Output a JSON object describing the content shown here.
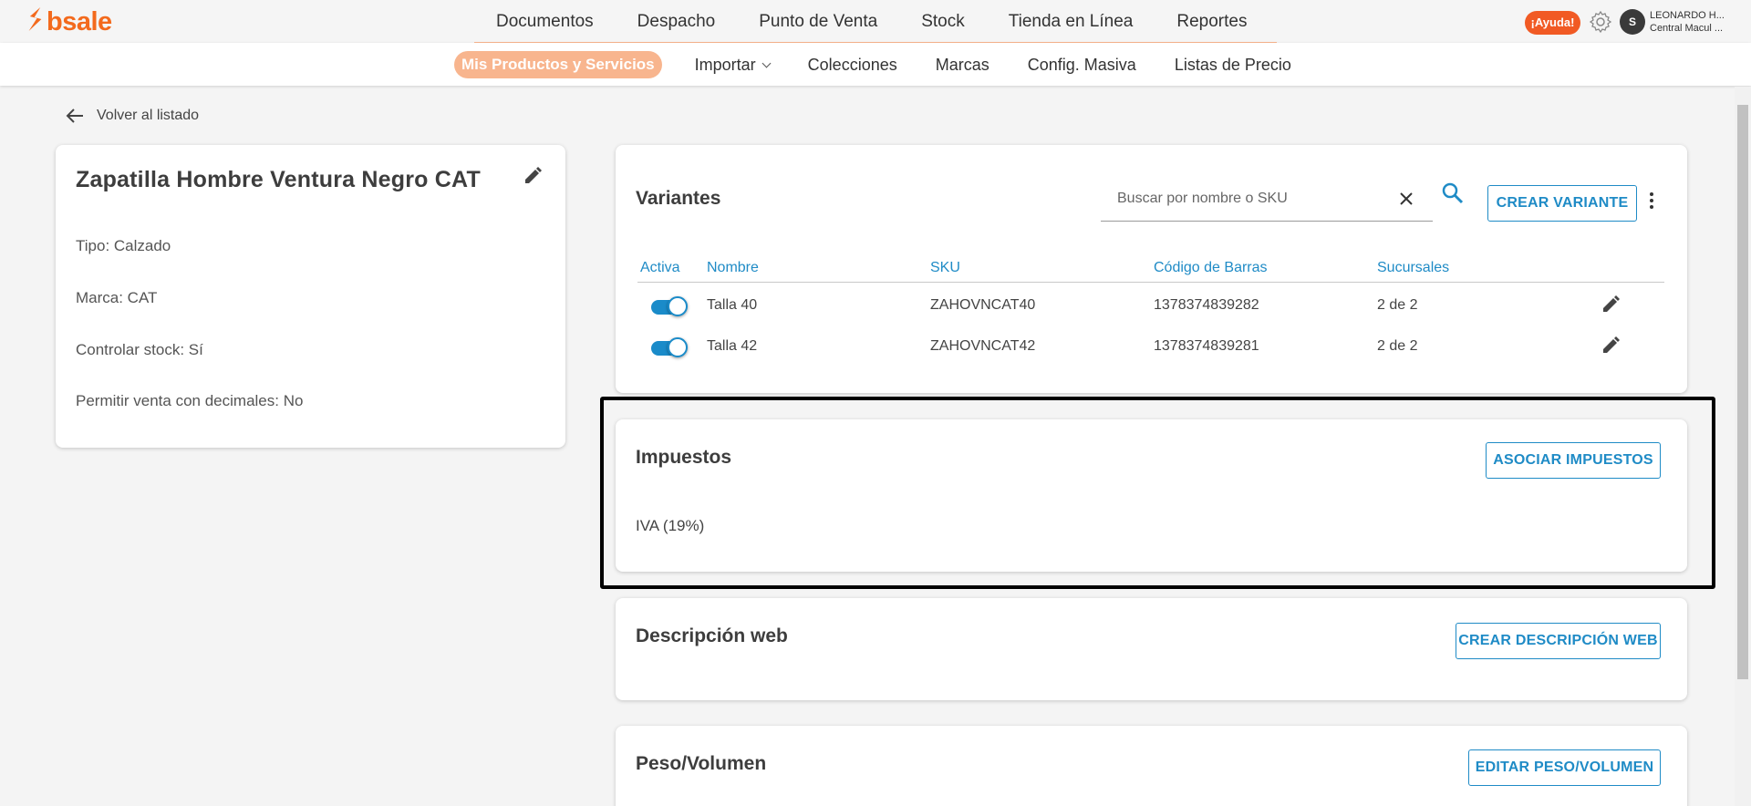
{
  "brand": {
    "logo_text": "bsale",
    "color": "#f36a1d"
  },
  "main_nav": [
    "Documentos",
    "Despacho",
    "Punto de Venta",
    "Stock",
    "Tienda en Línea",
    "Reportes"
  ],
  "header": {
    "help_label": "¡Ayuda!",
    "avatar_initial": "S",
    "user_name": "LEONARDO H...",
    "user_branch": "Central Macul ..."
  },
  "sub_nav": {
    "active": "Mis Productos y Servicios",
    "importar": "Importar",
    "items": [
      "Colecciones",
      "Marcas",
      "Config. Masiva",
      "Listas de Precio"
    ]
  },
  "back_label": "Volver al listado",
  "product": {
    "name": "Zapatilla Hombre Ventura Negro CAT",
    "properties": [
      "Tipo: Calzado",
      "Marca: CAT",
      "Controlar stock: Sí",
      "Permitir venta con decimales: No"
    ]
  },
  "variants": {
    "title": "Variantes",
    "search_placeholder": "Buscar por nombre o SKU",
    "create_label": "CREAR VARIANTE",
    "columns": [
      "Activa",
      "Nombre",
      "SKU",
      "Código de Barras",
      "Sucursales"
    ],
    "rows": [
      {
        "active": true,
        "name": "Talla 40",
        "sku": "ZAHOVNCAT40",
        "barcode": "1378374839282",
        "branches": "2 de 2"
      },
      {
        "active": true,
        "name": "Talla 42",
        "sku": "ZAHOVNCAT42",
        "barcode": "1378374839281",
        "branches": "2 de 2"
      }
    ]
  },
  "taxes": {
    "title": "Impuestos",
    "button_label": "ASOCIAR IMPUESTOS",
    "items": [
      "IVA (19%)"
    ]
  },
  "web_description": {
    "title": "Descripción web",
    "button_label": "CREAR DESCRIPCIÓN WEB"
  },
  "weight_volume": {
    "title": "Peso/Volumen",
    "button_label": "EDITAR PESO/VOLUMEN"
  },
  "colors": {
    "accent_blue": "#1f8bc6",
    "brand_orange": "#f15a24",
    "active_pill": "#f8b58e"
  }
}
